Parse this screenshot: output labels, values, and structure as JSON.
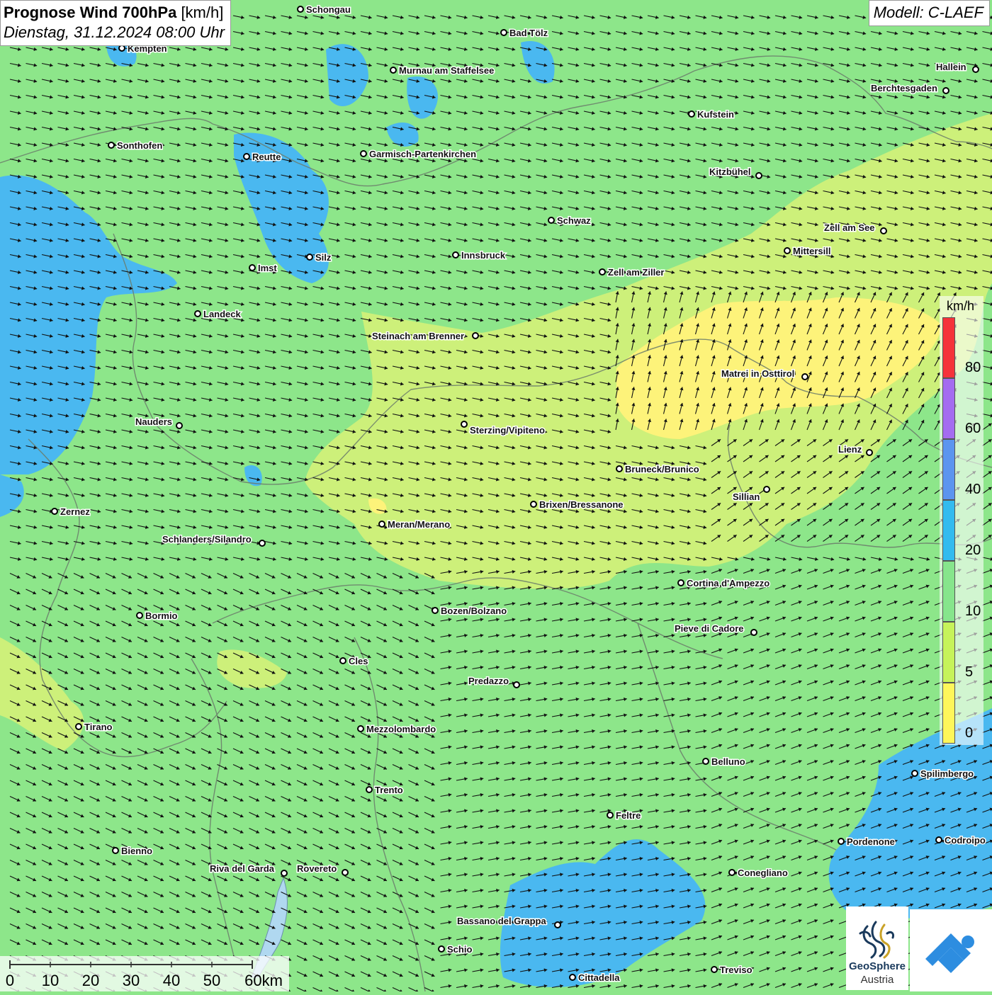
{
  "header": {
    "title_bold": "Prognose Wind 700hPa",
    "title_unit": "[km/h]",
    "datetime": "Dienstag, 31.12.2024 08:00 Uhr",
    "model": "Modell: C-LAEF"
  },
  "legend": {
    "unit": "km/h",
    "labels": [
      "80",
      "60",
      "40",
      "20",
      "10",
      "5",
      "0"
    ],
    "colors": [
      "#f5333a",
      "#a46cf0",
      "#5c95ef",
      "#33bbef",
      "#86e58c",
      "#c6f35a",
      "#fef65a"
    ]
  },
  "scale": {
    "ticks": [
      "0",
      "10",
      "20",
      "30",
      "40",
      "50",
      "60km"
    ]
  },
  "logo": {
    "brand_line1": "GeoSphere",
    "brand_line2": "Austria"
  },
  "cities": [
    {
      "name": "Schongau"
    },
    {
      "name": "Bad Tölz"
    },
    {
      "name": "Kempten"
    },
    {
      "name": "Murnau am Staffelsee"
    },
    {
      "name": "Hallein"
    },
    {
      "name": "Berchtesgaden"
    },
    {
      "name": "Kufstein"
    },
    {
      "name": "Sonthofen"
    },
    {
      "name": "Reutte"
    },
    {
      "name": "Garmisch-Partenkirchen"
    },
    {
      "name": "Kitzbühel"
    },
    {
      "name": "Schwaz"
    },
    {
      "name": "Zell am See"
    },
    {
      "name": "Mittersill"
    },
    {
      "name": "Silz"
    },
    {
      "name": "Innsbruck"
    },
    {
      "name": "Imst"
    },
    {
      "name": "Zell am Ziller"
    },
    {
      "name": "Landeck"
    },
    {
      "name": "Steinach am Brenner"
    },
    {
      "name": "Matrei in Osttirol"
    },
    {
      "name": "Nauders"
    },
    {
      "name": "Sterzing/Vipiteno"
    },
    {
      "name": "Lienz"
    },
    {
      "name": "Bruneck/Brunico"
    },
    {
      "name": "Sillian"
    },
    {
      "name": "Brixen/Bressanone"
    },
    {
      "name": "Zernez"
    },
    {
      "name": "Meran/Merano"
    },
    {
      "name": "Schlanders/Silandro"
    },
    {
      "name": "Cortina d'Ampezzo"
    },
    {
      "name": "Bozen/Bolzano"
    },
    {
      "name": "Bormio"
    },
    {
      "name": "Pieve di Cadore"
    },
    {
      "name": "Cles"
    },
    {
      "name": "Predazzo"
    },
    {
      "name": "Tirano"
    },
    {
      "name": "Mezzolombardo"
    },
    {
      "name": "Belluno"
    },
    {
      "name": "Spilimbergo"
    },
    {
      "name": "Trento"
    },
    {
      "name": "Feltre"
    },
    {
      "name": "Pordenone"
    },
    {
      "name": "Codroipo"
    },
    {
      "name": "Bienno"
    },
    {
      "name": "Riva del Garda"
    },
    {
      "name": "Rovereto"
    },
    {
      "name": "Conegliano"
    },
    {
      "name": "Bassano del Grappa"
    },
    {
      "name": "Schio"
    },
    {
      "name": "Treviso"
    },
    {
      "name": "Cittadella"
    }
  ]
}
